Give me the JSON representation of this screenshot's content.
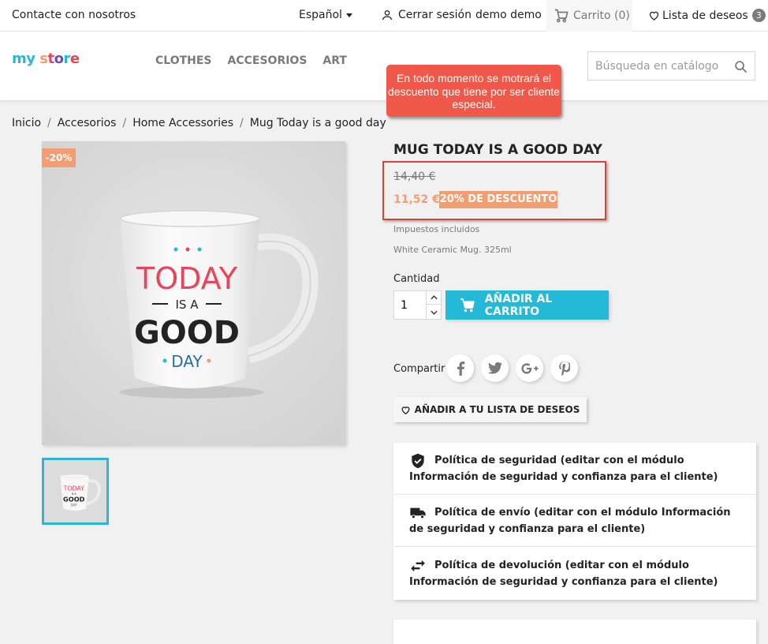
{
  "topbar": {
    "contact": "Contacte con nosotros",
    "language": "Español",
    "logout": "Cerrar sesión",
    "user": "demo demo",
    "cart": "Carrito (0)",
    "wishlist": "Lista de deseos",
    "wishlist_count": "3"
  },
  "header": {
    "logo": {
      "m": "m",
      "y": "y",
      "s": "s",
      "t": "t",
      "o": "o",
      "r": "r",
      "e": "e"
    },
    "nav": [
      "CLOTHES",
      "ACCESORIOS",
      "ART"
    ],
    "search_placeholder": "Búsqueda en catálogo"
  },
  "annotation": {
    "text": "En todo momento se motrará el descuento que tiene por ser cliente especial."
  },
  "breadcrumb": [
    "Inicio",
    "Accesorios",
    "Home Accessories",
    "Mug Today is a good day"
  ],
  "product": {
    "flag": "-20%",
    "image_text": {
      "line1": "TODAY",
      "line2": "IS A",
      "line3": "GOOD",
      "line4": "DAY"
    },
    "title": "MUG TODAY IS A GOOD DAY",
    "old_price": "14,40 €",
    "new_price": "11,52 €",
    "discount": "20% DE DESCUENTO",
    "tax": "Impuestos incluidos",
    "description": "White Ceramic Mug. 325ml",
    "quantity_label": "Cantidad",
    "quantity": "1",
    "add_to_cart": "AÑADIR AL CARRITO",
    "share_label": "Compartir",
    "wishlist_button": "AÑADIR A TU LISTA DE DESEOS"
  },
  "reassurance": [
    {
      "icon": "shield-icon",
      "text": "Política de seguridad (editar con el módulo Información de seguridad y confianza para el cliente)"
    },
    {
      "icon": "truck-icon",
      "text": "Política de envío (editar con el módulo Información de seguridad y confianza para el cliente)"
    },
    {
      "icon": "swap-arrows-icon",
      "text": "Política de devolución (editar con el módulo Información de seguridad y confianza para el cliente)"
    }
  ],
  "colors": {
    "accent": "#24b9d7",
    "discount": "#f39d72",
    "annotation": "#f0584a",
    "highlight_border": "#d0463a"
  }
}
